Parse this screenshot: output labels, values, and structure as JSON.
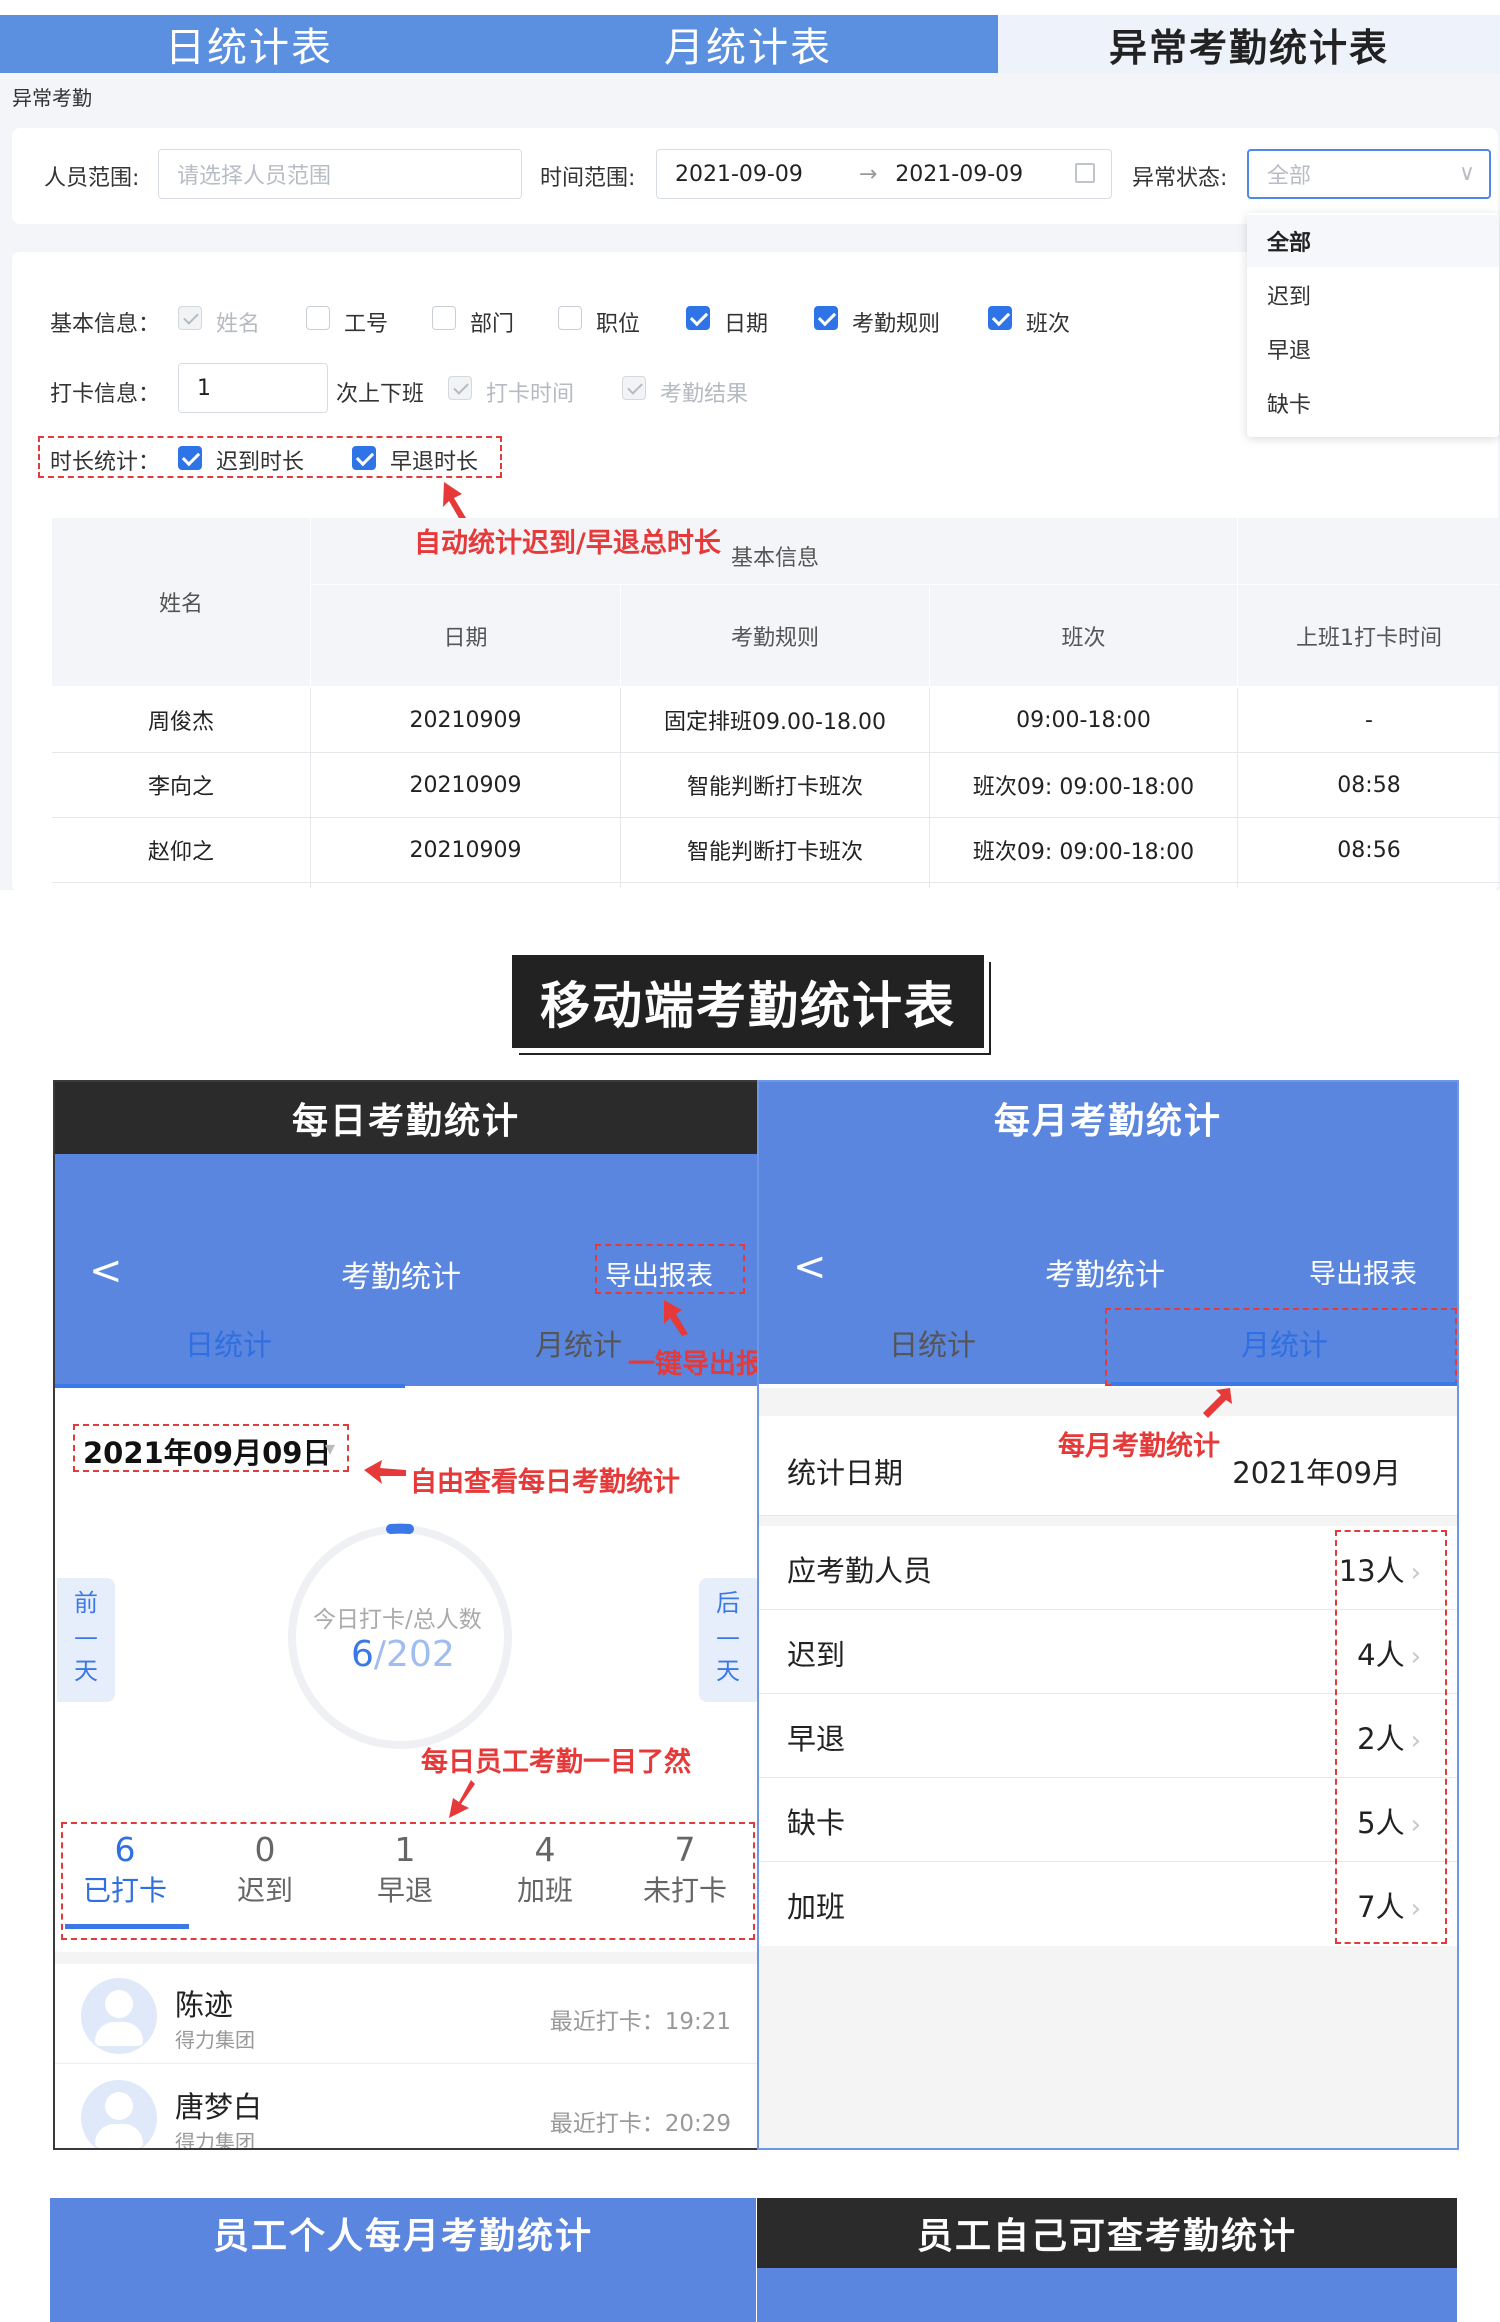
{
  "top_tabs": [
    "日统计表",
    "月统计表",
    "异常考勤统计表"
  ],
  "breadcrumb": "异常考勤",
  "filter": {
    "person_label": "人员范围:",
    "person_placeholder": "请选择人员范围",
    "time_label": "时间范围:",
    "date_start": "2021-09-09",
    "date_arrow": "→",
    "date_end": "2021-09-09",
    "status_label": "异常状态:",
    "status_placeholder": "全部"
  },
  "dropdown": [
    "全部",
    "迟到",
    "早退",
    "缺卡"
  ],
  "basic_info": {
    "label": "基本信息：",
    "options": [
      {
        "label": "姓名",
        "state": "disabled"
      },
      {
        "label": "工号",
        "state": "off"
      },
      {
        "label": "部门",
        "state": "off"
      },
      {
        "label": "职位",
        "state": "off"
      },
      {
        "label": "日期",
        "state": "on"
      },
      {
        "label": "考勤规则",
        "state": "on"
      },
      {
        "label": "班次",
        "state": "on"
      }
    ]
  },
  "punch_info": {
    "label": "打卡信息：",
    "count": "1",
    "suffix": "次上下班",
    "opt1": "打卡时间",
    "opt2": "考勤结果"
  },
  "duration": {
    "label": "时长统计：",
    "opt1": "迟到时长",
    "opt2": "早退时长"
  },
  "annotations": {
    "a1": "自动统计迟到/早退总时长",
    "a2": "一键导出报表",
    "a3": "自由查看每日考勤统计",
    "a4": "每日员工考勤一目了然",
    "a5": "每月考勤统计"
  },
  "table": {
    "group_header": "基本信息",
    "headers": [
      "姓名",
      "日期",
      "考勤规则",
      "班次",
      "上班1打卡时间"
    ],
    "rows": [
      [
        "周俊杰",
        "20210909",
        "固定排班09.00-18.00",
        "09:00-18:00",
        "-"
      ],
      [
        "李向之",
        "20210909",
        "智能判断打卡班次",
        "班次09: 09:00-18:00",
        "08:58"
      ],
      [
        "赵仰之",
        "20210909",
        "智能判断打卡班次",
        "班次09: 09:00-18:00",
        "08:56"
      ]
    ]
  },
  "mobile_title": "移动端考勤统计表",
  "daily": {
    "header": "每日考勤统计",
    "nav_back": "<",
    "nav_title": "考勤统计",
    "export": "导出报表",
    "tab_day": "日统计",
    "tab_month": "月统计",
    "date": "2021年09月09日",
    "prev": [
      "前",
      "—",
      "天"
    ],
    "next": [
      "后",
      "—",
      "天"
    ],
    "ring_label": "今日打卡/总人数",
    "ring_value": "6",
    "ring_total": "/202",
    "stats": [
      {
        "num": "6",
        "label": "已打卡"
      },
      {
        "num": "0",
        "label": "迟到"
      },
      {
        "num": "1",
        "label": "早退"
      },
      {
        "num": "4",
        "label": "加班"
      },
      {
        "num": "7",
        "label": "未打卡"
      }
    ],
    "people": [
      {
        "name": "陈迹",
        "org": "得力集团",
        "last": "最近打卡：19:21"
      },
      {
        "name": "唐梦白",
        "org": "得力集团",
        "last": "最近打卡：20:29"
      }
    ]
  },
  "monthly": {
    "header": "每月考勤统计",
    "nav_back": "<",
    "nav_title": "考勤统计",
    "export": "导出报表",
    "tab_day": "日统计",
    "tab_month": "月统计",
    "date_label": "统计日期",
    "date_value": "2021年09月",
    "rows": [
      {
        "label": "应考勤人员",
        "value": "13人"
      },
      {
        "label": "迟到",
        "value": "4人"
      },
      {
        "label": "早退",
        "value": "2人"
      },
      {
        "label": "缺卡",
        "value": "5人"
      },
      {
        "label": "加班",
        "value": "7人"
      }
    ]
  },
  "bottom": {
    "left": "员工个人每月考勤统计",
    "right": "员工自己可查考勤统计"
  },
  "colors": {
    "primary_blue": "#5b8fe0",
    "check_blue": "#2f74e6",
    "annotation_red": "#e63a3a",
    "dark": "#222222"
  }
}
